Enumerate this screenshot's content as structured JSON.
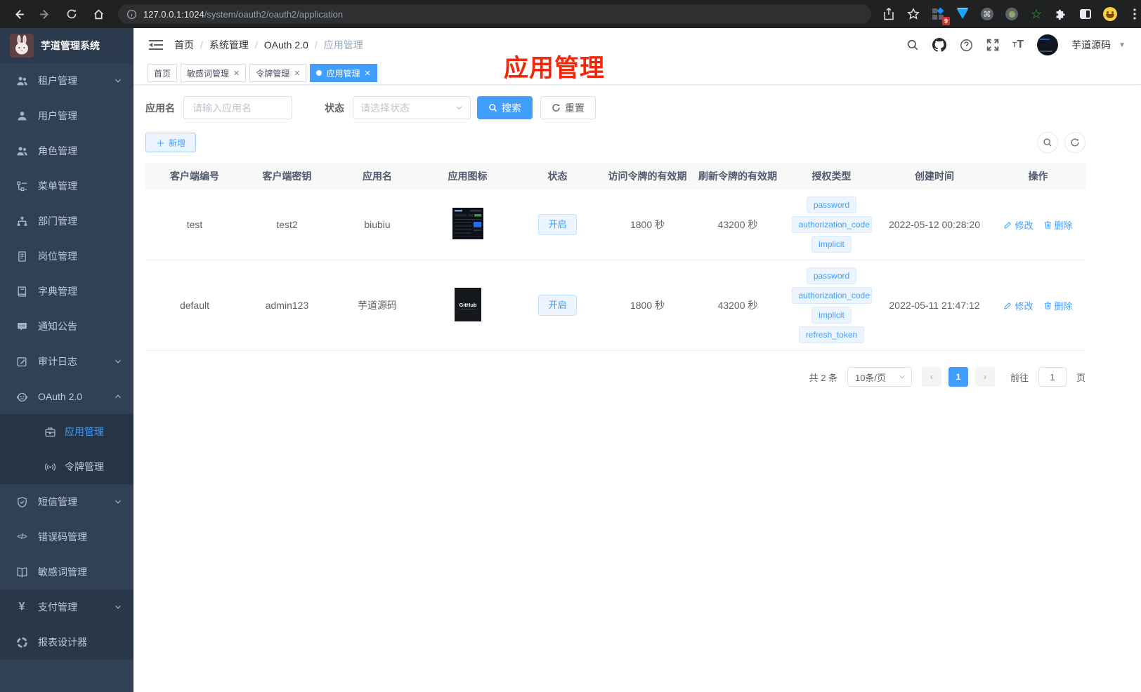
{
  "browser": {
    "url_host": "127.0.0.1:1024",
    "url_path": "/system/oauth2/oauth2/application",
    "extension_badge": "9"
  },
  "sidebar": {
    "app_title": "芋道管理系统",
    "items": [
      {
        "key": "tenant",
        "label": "租户管理",
        "icon": "users-icon",
        "chevron": "down"
      },
      {
        "key": "user",
        "label": "用户管理",
        "icon": "user-icon"
      },
      {
        "key": "role",
        "label": "角色管理",
        "icon": "users-icon"
      },
      {
        "key": "menu",
        "label": "菜单管理",
        "icon": "tree-icon"
      },
      {
        "key": "dept",
        "label": "部门管理",
        "icon": "org-icon"
      },
      {
        "key": "post",
        "label": "岗位管理",
        "icon": "badge-icon"
      },
      {
        "key": "dict",
        "label": "字典管理",
        "icon": "dict-icon"
      },
      {
        "key": "notice",
        "label": "通知公告",
        "icon": "message-icon"
      },
      {
        "key": "audit",
        "label": "审计日志",
        "icon": "log-icon",
        "chevron": "down"
      },
      {
        "key": "oauth2",
        "label": "OAuth 2.0",
        "icon": "robot-icon",
        "chevron": "up",
        "children": [
          {
            "key": "oauth2-app",
            "label": "应用管理",
            "icon": "briefcase-icon",
            "active": true
          },
          {
            "key": "oauth2-token",
            "label": "令牌管理",
            "icon": "signal-icon"
          }
        ]
      },
      {
        "key": "sms",
        "label": "短信管理",
        "icon": "shield-icon",
        "chevron": "down"
      },
      {
        "key": "errcode",
        "label": "错误码管理",
        "icon": "code-icon"
      },
      {
        "key": "sensitive",
        "label": "敏感词管理",
        "icon": "book-icon"
      },
      {
        "key": "pay",
        "label": "支付管理",
        "icon": "yen-icon",
        "chevron": "down",
        "section": "dark"
      },
      {
        "key": "report",
        "label": "报表设计器",
        "icon": "report-icon",
        "section": "dark"
      }
    ]
  },
  "header": {
    "breadcrumb": [
      "首页",
      "系统管理",
      "OAuth 2.0",
      "应用管理"
    ],
    "username": "芋道源码"
  },
  "tabs": [
    {
      "key": "home",
      "label": "首页",
      "closable": false,
      "active": false
    },
    {
      "key": "sensitive",
      "label": "敏感词管理",
      "closable": true,
      "active": false
    },
    {
      "key": "token",
      "label": "令牌管理",
      "closable": true,
      "active": false
    },
    {
      "key": "app",
      "label": "应用管理",
      "closable": true,
      "active": true
    }
  ],
  "annotation": {
    "text": "应用管理",
    "color": "#f5270b"
  },
  "filters": {
    "app_name_label": "应用名",
    "app_name_placeholder": "请输入应用名",
    "status_label": "状态",
    "status_placeholder": "请选择状态",
    "search_label": "搜索",
    "reset_label": "重置"
  },
  "toolbar": {
    "add_label": "新增"
  },
  "table": {
    "columns": [
      "客户端编号",
      "客户端密钥",
      "应用名",
      "应用图标",
      "状态",
      "访问令牌的有效期",
      "刷新令牌的有效期",
      "授权类型",
      "创建时间",
      "操作"
    ],
    "rows": [
      {
        "client_id": "test",
        "client_secret": "test2",
        "app_name": "biubiu",
        "icon_kind": "screenshot-thumb",
        "status": "开启",
        "access_ttl": "1800 秒",
        "refresh_ttl": "43200 秒",
        "grant_types": [
          "password",
          "authorization_code",
          "implicit"
        ],
        "created_at": "2022-05-12 00:28:20"
      },
      {
        "client_id": "default",
        "client_secret": "admin123",
        "app_name": "芋道源码",
        "icon_kind": "github-thumb",
        "status": "开启",
        "access_ttl": "1800 秒",
        "refresh_ttl": "43200 秒",
        "grant_types": [
          "password",
          "authorization_code",
          "implicit",
          "refresh_token"
        ],
        "created_at": "2022-05-11 21:47:12"
      }
    ],
    "actions": {
      "edit": "修改",
      "delete": "删除"
    }
  },
  "pagination": {
    "total": "共 2 条",
    "page_size": "10条/页",
    "current_page": "1",
    "goto_label": "前往",
    "goto_value": "1",
    "page_unit": "页"
  },
  "colors": {
    "accent": "#409eff",
    "annotation_red": "#f5270b",
    "sidebar_bg": "#304156"
  }
}
